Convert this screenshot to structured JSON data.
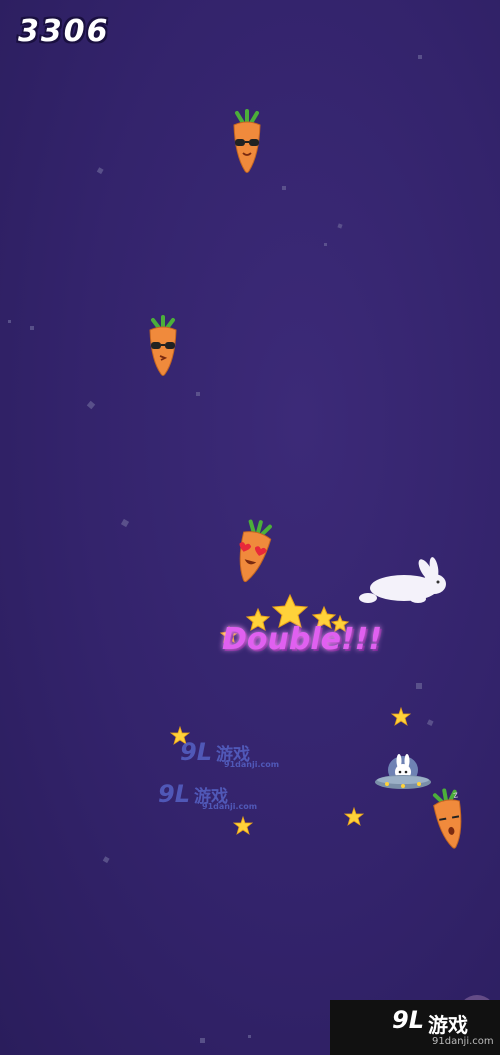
{
  "hud": {
    "score": "3306"
  },
  "combo": {
    "text": "Double!!!"
  },
  "watermarks": [
    {
      "brand": "9L",
      "cn": "游戏",
      "url": "91danji.com"
    },
    {
      "brand": "9L",
      "cn": "游戏",
      "url": "91danji.com"
    }
  ],
  "corner_watermark": {
    "brand": "9L",
    "cn": "游戏",
    "url": "91danji.com"
  },
  "icons": {
    "carrot": "carrot-icon",
    "rabbit": "rabbit-icon",
    "ufo": "ufo-rabbit-icon",
    "star": "star-icon"
  },
  "colors": {
    "background": "#33236b",
    "carrot": "#f08a3c",
    "leaf": "#4caf3a",
    "star": "#ffd23a",
    "combo": "#e060f0"
  }
}
